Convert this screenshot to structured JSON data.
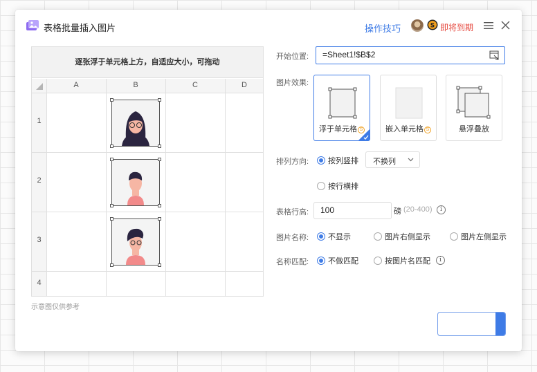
{
  "dialog": {
    "title": "表格批量插入图片",
    "tips_link": "操作技巧",
    "expire_text": "即将到期"
  },
  "preview": {
    "header": "逐张浮于单元格上方，自适应大小，可拖动",
    "columns": [
      "A",
      "B",
      "C",
      "D"
    ],
    "rows": [
      "1",
      "2",
      "3",
      "4"
    ],
    "note": "示意图仅供参考"
  },
  "form": {
    "start": {
      "label": "开始位置:",
      "value": "=Sheet1!$B$2"
    },
    "effect": {
      "label": "图片效果:",
      "options": [
        {
          "label": "浮于单元格",
          "paid": true,
          "selected": true
        },
        {
          "label": "嵌入单元格",
          "paid": true,
          "selected": false
        },
        {
          "label": "悬浮叠放",
          "paid": false,
          "selected": false
        }
      ],
      "coin_symbol": "S"
    },
    "direction": {
      "label": "排列方向:",
      "option_col": "按列竖排",
      "option_row": "按行横排",
      "selected": "按列竖排",
      "wrap_select": "不换列"
    },
    "row_height": {
      "label": "表格行高:",
      "value": "100",
      "unit": "磅",
      "range": "(20-400)"
    },
    "pic_name": {
      "label": "图片名称:",
      "options": [
        "不显示",
        "图片右侧显示",
        "图片左侧显示"
      ],
      "selected": "不显示"
    },
    "name_match": {
      "label": "名称匹配:",
      "options": [
        "不做匹配",
        "按图片名匹配"
      ],
      "selected": "不做匹配"
    },
    "info_symbol": "i"
  },
  "colors": {
    "accent": "#3e7be6",
    "warning": "#e5463c",
    "coin": "#f0a020"
  },
  "icons": [
    "app-image-icon",
    "expire-s-icon",
    "menu-icon",
    "close-icon",
    "range-select-icon",
    "chevron-down-icon",
    "info-icon",
    "check-icon"
  ]
}
